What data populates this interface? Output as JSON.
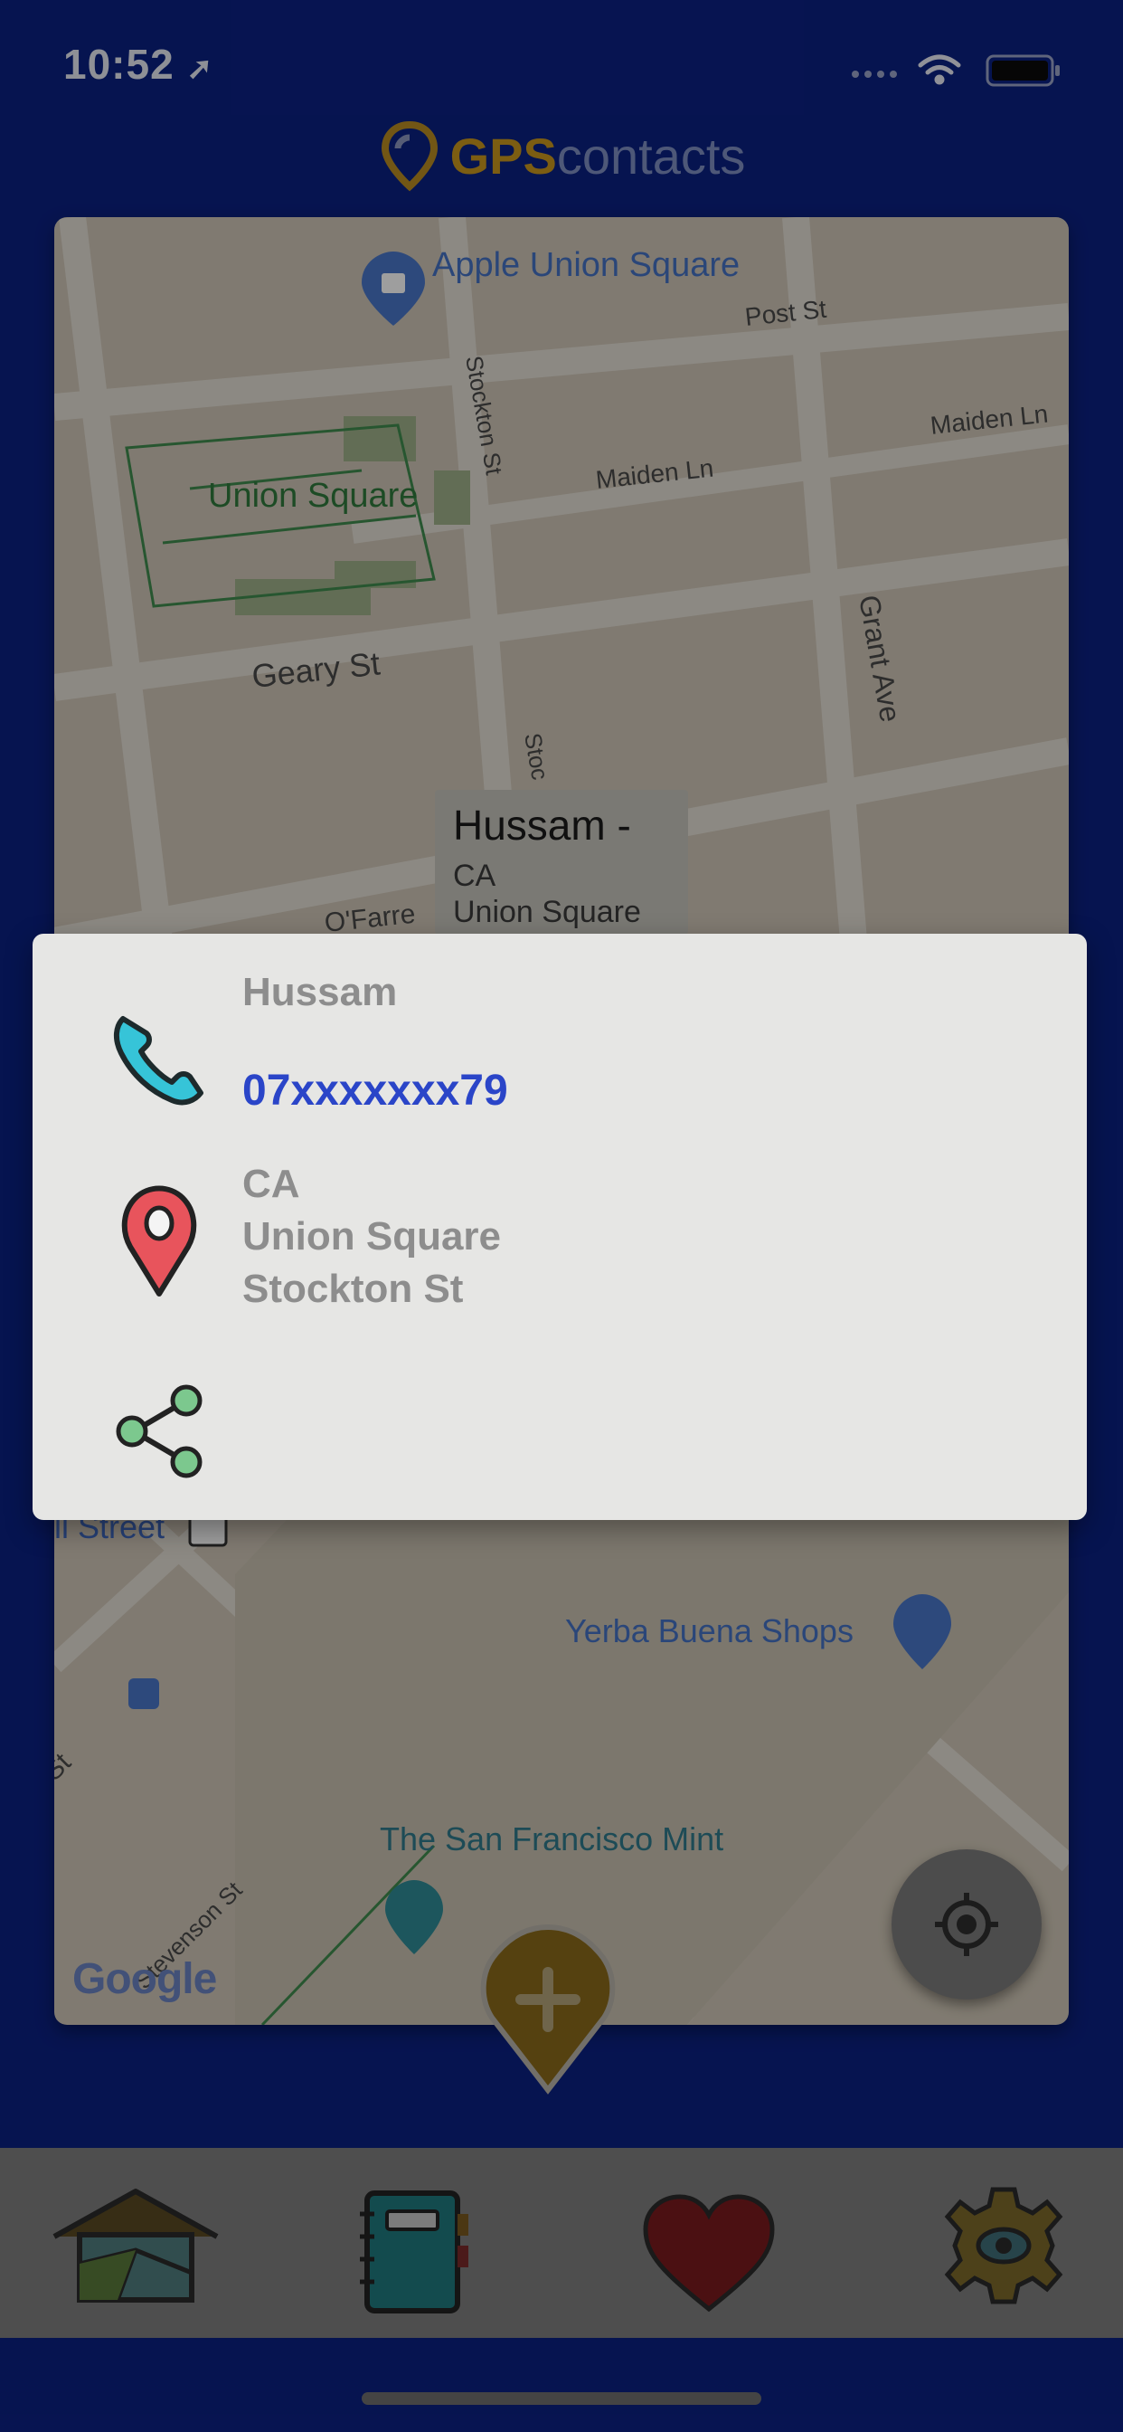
{
  "status_bar": {
    "time": "10:52"
  },
  "header": {
    "logo_part1": "GPS",
    "logo_part2": "contacts"
  },
  "map": {
    "labels": {
      "apple_store": "Apple Union Square",
      "post_st": "Post St",
      "maiden_ln_right": "Maiden Ln",
      "maiden_ln_mid": "Maiden Ln",
      "union_square": "Union Square",
      "stockton_st": "Stockton St",
      "geary_st": "Geary St",
      "grant_ave": "Grant Ave",
      "ofarrell": "O'Farre",
      "stoc": "Stoc",
      "ell_street": "ll Street",
      "yerba_buena": "Yerba Buena Shops",
      "sf_mint": "The San Francisco Mint",
      "stevenson_st": "Stevenson St",
      "st_partial": "St"
    },
    "google_logo": "Google",
    "info_window": {
      "title": "Hussam -",
      "line1": "CA",
      "line2": "Union Square"
    }
  },
  "popup": {
    "name": "Hussam",
    "phone": "07xxxxxxx79",
    "address_lines": [
      "CA",
      "Union Square",
      "Stockton St"
    ]
  },
  "icons": {
    "phone": "phone-icon",
    "location": "location-pin-icon",
    "share": "share-icon",
    "locate": "crosshair-icon",
    "add": "add-pin-icon",
    "tabs": [
      "home-icon",
      "contacts-book-icon",
      "heart-icon",
      "gear-icon"
    ]
  },
  "colors": {
    "background": "#0b2182",
    "popup": "#e6e6e4",
    "phone_link": "#2a45c8",
    "accent_gold": "#c8961e"
  }
}
